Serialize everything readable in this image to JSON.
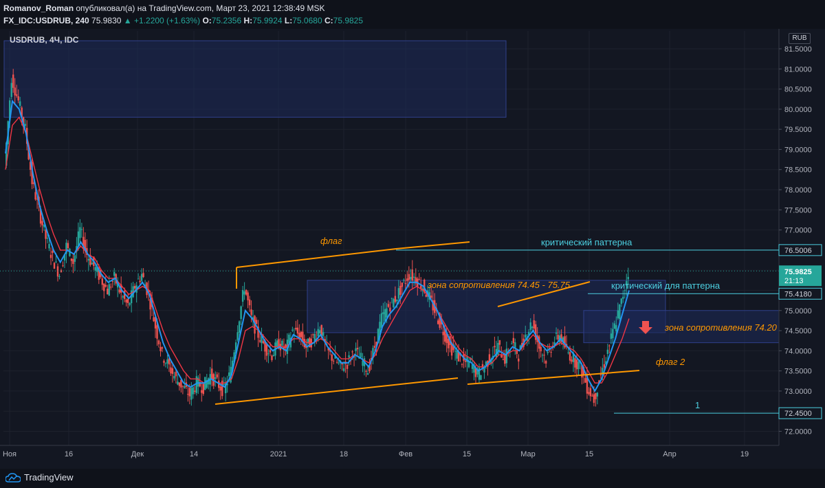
{
  "header": {
    "author": "Romanov_Roman",
    "published_text": "опубликовал(а) на TradingView.com, Март 23, 2021 12:38:49 MSK",
    "symbol_full": "FX_IDC:USDRUB, 240",
    "last": "75.9830",
    "change": "+1.2200 (+1.63%)",
    "o_label": "O:",
    "o": "75.2356",
    "h_label": "H:",
    "h": "75.9924",
    "l_label": "L:",
    "l": "75.0680",
    "c_label": "C:",
    "c": "75.9825"
  },
  "chart_label": "USDRUB, 4Ч, IDC",
  "currency": "RUB",
  "footer": {
    "brand": "TradingView"
  },
  "colors": {
    "background": "#131722",
    "up": "#26a69a",
    "down": "#ef5350",
    "ma_fast": "#2196f3",
    "ma_slow": "#f23645",
    "annotation_orange": "#ff9800",
    "annotation_cyan": "#4dd0e1",
    "zone_fill": "#1e2a5a"
  },
  "chart_data": {
    "type": "candlestick",
    "symbol": "USDRUB",
    "timeframe": "4Ч",
    "y_axis": {
      "range": [
        71.8,
        81.8
      ],
      "ticks": [
        "72.0000",
        "72.5000",
        "73.0000",
        "73.5000",
        "74.0000",
        "74.5000",
        "75.0000",
        "75.5000",
        "76.0000",
        "76.5000",
        "77.0000",
        "77.5000",
        "78.0000",
        "78.5000",
        "79.0000",
        "79.5000",
        "80.0000",
        "80.5000",
        "81.0000",
        "81.5000"
      ]
    },
    "x_axis": {
      "ticks": [
        "Ноя",
        "16",
        "Дек",
        "14",
        "2021",
        "18",
        "Фев",
        "15",
        "Мар",
        "15",
        "Апр",
        "19"
      ]
    },
    "price_labels": [
      {
        "text": "76.5006",
        "value": 76.5006,
        "style": "level"
      },
      {
        "text": "75.9825",
        "value": 75.9825,
        "style": "last",
        "countdown": "21:13"
      },
      {
        "text": "75.4180",
        "value": 75.418,
        "style": "level"
      },
      {
        "text": "74.2000",
        "value": 74.2,
        "style": "hidden"
      },
      {
        "text": "72.4500",
        "value": 72.45,
        "style": "level"
      }
    ],
    "series_close": [
      78.6,
      80.8,
      80.2,
      79.5,
      78.2,
      77.5,
      76.8,
      76.3,
      75.9,
      76.6,
      76.2,
      77.0,
      76.4,
      76.1,
      75.8,
      75.5,
      75.8,
      75.4,
      75.1,
      75.6,
      75.9,
      75.4,
      74.6,
      73.9,
      73.6,
      73.3,
      73.1,
      72.9,
      73.2,
      73.1,
      73.4,
      73.2,
      73.0,
      73.5,
      74.6,
      75.6,
      74.8,
      74.4,
      74.1,
      73.9,
      74.2,
      74.0,
      74.5,
      74.4,
      74.1,
      74.3,
      74.6,
      74.0,
      73.8,
      73.6,
      73.7,
      74.0,
      73.8,
      73.5,
      74.1,
      74.8,
      75.1,
      75.3,
      75.6,
      75.9,
      75.8,
      75.6,
      75.3,
      74.9,
      74.5,
      74.1,
      73.9,
      73.7,
      73.7,
      73.4,
      73.6,
      73.9,
      74.1,
      73.8,
      74.2,
      73.9,
      74.4,
      74.7,
      74.1,
      73.8,
      74.2,
      74.4,
      74.0,
      73.8,
      73.6,
      73.1,
      72.8,
      73.4,
      74.0,
      74.6,
      75.2,
      75.98
    ],
    "ma_fast_values": [
      78.9,
      80.2,
      80.0,
      79.4,
      78.4,
      77.6,
      77.0,
      76.5,
      76.2,
      76.5,
      76.4,
      76.7,
      76.4,
      76.2,
      75.9,
      75.7,
      75.8,
      75.5,
      75.3,
      75.5,
      75.7,
      75.4,
      74.8,
      74.2,
      73.8,
      73.5,
      73.2,
      73.1,
      73.2,
      73.2,
      73.3,
      73.2,
      73.1,
      73.4,
      74.2,
      75.0,
      74.8,
      74.5,
      74.2,
      74.0,
      74.1,
      74.0,
      74.4,
      74.3,
      74.1,
      74.2,
      74.4,
      74.1,
      73.9,
      73.7,
      73.7,
      73.9,
      73.8,
      73.6,
      74.0,
      74.6,
      74.9,
      75.1,
      75.4,
      75.7,
      75.7,
      75.6,
      75.3,
      75.0,
      74.6,
      74.2,
      74.0,
      73.8,
      73.7,
      73.5,
      73.6,
      73.8,
      74.0,
      73.9,
      74.1,
      74.0,
      74.3,
      74.5,
      74.2,
      74.0,
      74.1,
      74.3,
      74.1,
      73.9,
      73.7,
      73.3,
      73.0,
      73.3,
      73.8,
      74.3,
      74.9,
      75.5
    ],
    "ma_slow_values": [
      78.5,
      79.6,
      79.8,
      79.4,
      78.7,
      78.0,
      77.4,
      76.9,
      76.5,
      76.5,
      76.4,
      76.6,
      76.4,
      76.3,
      76.0,
      75.8,
      75.8,
      75.6,
      75.4,
      75.5,
      75.6,
      75.5,
      75.0,
      74.5,
      74.1,
      73.8,
      73.5,
      73.3,
      73.3,
      73.2,
      73.3,
      73.2,
      73.2,
      73.3,
      73.8,
      74.5,
      74.6,
      74.5,
      74.3,
      74.1,
      74.1,
      74.1,
      74.3,
      74.3,
      74.2,
      74.2,
      74.3,
      74.2,
      74.0,
      73.8,
      73.8,
      73.9,
      73.8,
      73.7,
      73.9,
      74.3,
      74.6,
      74.9,
      75.2,
      75.5,
      75.6,
      75.5,
      75.3,
      75.0,
      74.7,
      74.4,
      74.1,
      73.9,
      73.8,
      73.6,
      73.6,
      73.7,
      73.9,
      73.9,
      74.0,
      74.0,
      74.2,
      74.4,
      74.2,
      74.1,
      74.1,
      74.2,
      74.1,
      74.0,
      73.8,
      73.5,
      73.2,
      73.2,
      73.5,
      73.9,
      74.3,
      74.8
    ],
    "annotations": [
      {
        "kind": "text",
        "text": "флаг",
        "color": "orange",
        "italic": true
      },
      {
        "kind": "text",
        "text": "критический паттерна",
        "color": "cyan"
      },
      {
        "kind": "text",
        "text": "зона сопротивления 74.45 - 75.75",
        "color": "orange",
        "italic": true
      },
      {
        "kind": "text",
        "text": "критический для паттерна",
        "color": "cyan"
      },
      {
        "kind": "text",
        "text": "зона сопротивления 74.20",
        "color": "orange",
        "italic": true
      },
      {
        "kind": "text",
        "text": "флаг 2",
        "color": "orange",
        "italic": true
      },
      {
        "kind": "text",
        "text": "1",
        "color": "cyan"
      }
    ],
    "zones": [
      {
        "name": "top-zone",
        "y_low": 79.8,
        "y_high": 81.7
      },
      {
        "name": "resistance-74.45-75.75",
        "y_low": 74.45,
        "y_high": 75.75
      },
      {
        "name": "resistance-74.20",
        "y_low": 74.2,
        "y_high": 75.0
      }
    ]
  }
}
